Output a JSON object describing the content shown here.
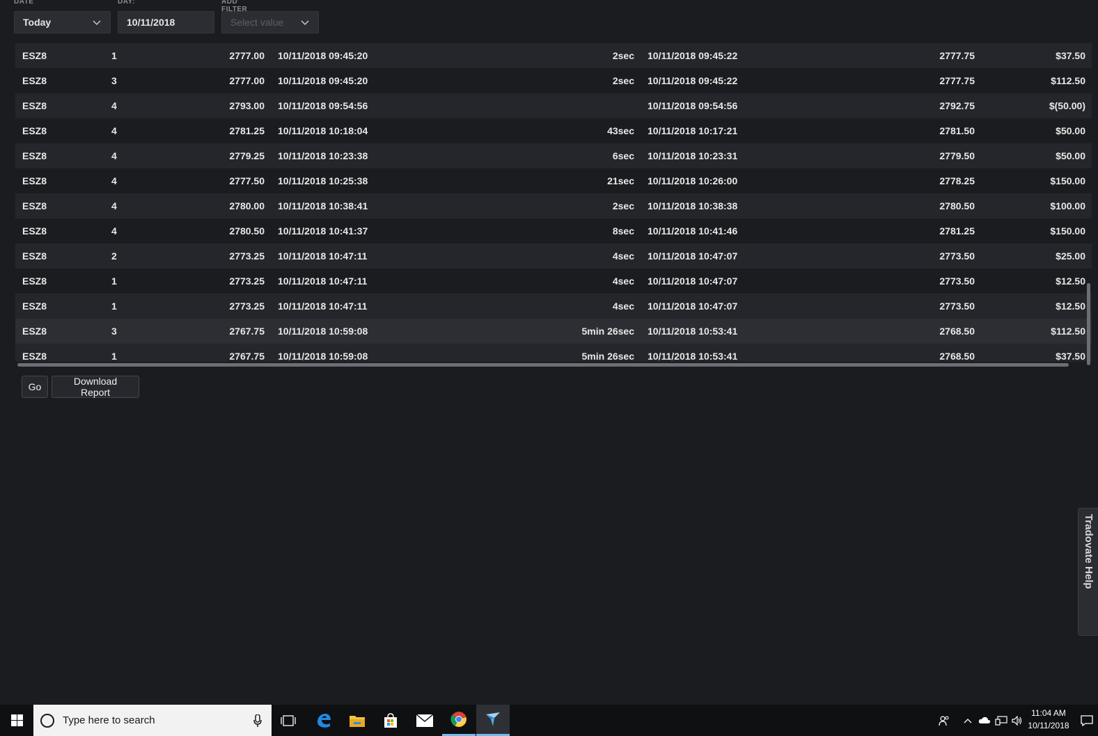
{
  "filters": {
    "date": {
      "label": "DATE",
      "value": "Today"
    },
    "day": {
      "label": "DAY:",
      "value": "10/11/2018"
    },
    "add_filter": {
      "label": "ADD FILTER",
      "placeholder": "Select value"
    }
  },
  "rows": [
    {
      "symbol": "ESZ8",
      "qty": "1",
      "price": "2777.00",
      "time1": "10/11/2018 09:45:20",
      "duration": "2sec",
      "time2": "10/11/2018 09:45:22",
      "price2": "2777.75",
      "pnl": "$37.50"
    },
    {
      "symbol": "ESZ8",
      "qty": "3",
      "price": "2777.00",
      "time1": "10/11/2018 09:45:20",
      "duration": "2sec",
      "time2": "10/11/2018 09:45:22",
      "price2": "2777.75",
      "pnl": "$112.50"
    },
    {
      "symbol": "ESZ8",
      "qty": "4",
      "price": "2793.00",
      "time1": "10/11/2018 09:54:56",
      "duration": "",
      "time2": "10/11/2018 09:54:56",
      "price2": "2792.75",
      "pnl": "$(50.00)"
    },
    {
      "symbol": "ESZ8",
      "qty": "4",
      "price": "2781.25",
      "time1": "10/11/2018 10:18:04",
      "duration": "43sec",
      "time2": "10/11/2018 10:17:21",
      "price2": "2781.50",
      "pnl": "$50.00"
    },
    {
      "symbol": "ESZ8",
      "qty": "4",
      "price": "2779.25",
      "time1": "10/11/2018 10:23:38",
      "duration": "6sec",
      "time2": "10/11/2018 10:23:31",
      "price2": "2779.50",
      "pnl": "$50.00"
    },
    {
      "symbol": "ESZ8",
      "qty": "4",
      "price": "2777.50",
      "time1": "10/11/2018 10:25:38",
      "duration": "21sec",
      "time2": "10/11/2018 10:26:00",
      "price2": "2778.25",
      "pnl": "$150.00"
    },
    {
      "symbol": "ESZ8",
      "qty": "4",
      "price": "2780.00",
      "time1": "10/11/2018 10:38:41",
      "duration": "2sec",
      "time2": "10/11/2018 10:38:38",
      "price2": "2780.50",
      "pnl": "$100.00"
    },
    {
      "symbol": "ESZ8",
      "qty": "4",
      "price": "2780.50",
      "time1": "10/11/2018 10:41:37",
      "duration": "8sec",
      "time2": "10/11/2018 10:41:46",
      "price2": "2781.25",
      "pnl": "$150.00"
    },
    {
      "symbol": "ESZ8",
      "qty": "2",
      "price": "2773.25",
      "time1": "10/11/2018 10:47:11",
      "duration": "4sec",
      "time2": "10/11/2018 10:47:07",
      "price2": "2773.50",
      "pnl": "$25.00"
    },
    {
      "symbol": "ESZ8",
      "qty": "1",
      "price": "2773.25",
      "time1": "10/11/2018 10:47:11",
      "duration": "4sec",
      "time2": "10/11/2018 10:47:07",
      "price2": "2773.50",
      "pnl": "$12.50"
    },
    {
      "symbol": "ESZ8",
      "qty": "1",
      "price": "2773.25",
      "time1": "10/11/2018 10:47:11",
      "duration": "4sec",
      "time2": "10/11/2018 10:47:07",
      "price2": "2773.50",
      "pnl": "$12.50"
    },
    {
      "symbol": "ESZ8",
      "qty": "3",
      "price": "2767.75",
      "time1": "10/11/2018 10:59:08",
      "duration": "5min 26sec",
      "time2": "10/11/2018 10:53:41",
      "price2": "2768.50",
      "pnl": "$112.50"
    },
    {
      "symbol": "ESZ8",
      "qty": "1",
      "price": "2767.75",
      "time1": "10/11/2018 10:59:08",
      "duration": "5min 26sec",
      "time2": "10/11/2018 10:53:41",
      "price2": "2768.50",
      "pnl": "$37.50"
    }
  ],
  "buttons": {
    "go": "Go",
    "download": "Download Report"
  },
  "help_tab": {
    "label": "Tradovate Help"
  },
  "taskbar": {
    "search_placeholder": "Type here to search",
    "time": "11:04 AM",
    "date": "10/11/2018",
    "icons": [
      "task-view-icon",
      "edge-icon",
      "file-explorer-icon",
      "store-icon",
      "mail-icon",
      "chrome-icon",
      "tradovate-icon"
    ]
  },
  "colors": {
    "background": "#1b1c20",
    "row_alt": "#24262b",
    "row_highlight": "#2c2e33",
    "accent": "#76b9ed"
  }
}
